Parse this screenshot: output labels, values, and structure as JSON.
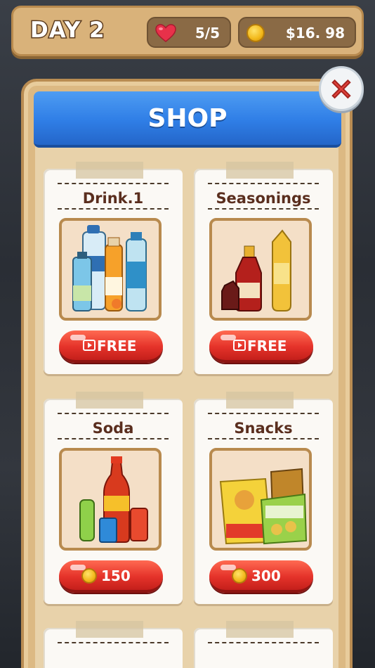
{
  "header": {
    "day_label": "DAY 2",
    "lives": "5/5",
    "money": "$16. 98",
    "lives_icon": "heart-icon",
    "money_icon": "coin-icon"
  },
  "shop": {
    "title": "SHOP",
    "close_icon": "close-icon"
  },
  "items": [
    {
      "name": "Drink.1",
      "button_label": "FREE",
      "button_type": "video"
    },
    {
      "name": "Seasonings",
      "button_label": "FREE",
      "button_type": "video"
    },
    {
      "name": "Soda",
      "button_label": "150",
      "button_type": "coin"
    },
    {
      "name": "Snacks",
      "button_label": "300",
      "button_type": "coin"
    }
  ],
  "colors": {
    "accent_red": "#e5332a",
    "banner_blue": "#2f7ee6",
    "panel_tan": "#dcb983"
  }
}
